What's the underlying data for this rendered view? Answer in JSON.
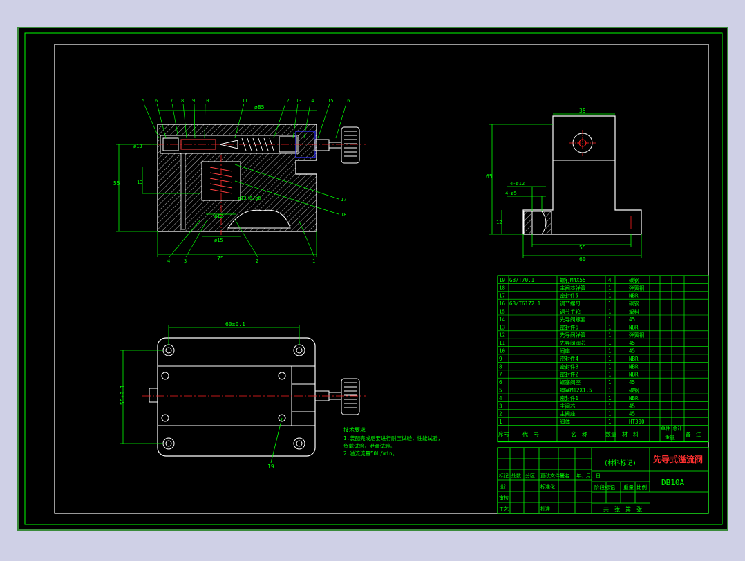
{
  "colors": {
    "background": "#cfd0e6",
    "paper": "#000000",
    "line": "#ffffff",
    "dimension": "#00ff00",
    "leader": "#00ff00",
    "center": "#ff2020",
    "hidden": "#3333ff",
    "hatch": "#ffffff"
  },
  "front_view": {
    "labels": {
      "top_width": "ø85",
      "bottom_width": "75",
      "left_height": "55",
      "small_h": "13",
      "dia_top": "ø13",
      "fit": "ø13H6/g5",
      "d12": "ø12",
      "d15": "ø15"
    },
    "part_numbers_top": [
      "5",
      "6",
      "7",
      "8",
      "9",
      "10",
      "11",
      "12",
      "13",
      "14",
      "15",
      "16"
    ],
    "part_numbers_right": [
      "17",
      "18"
    ],
    "part_numbers_bottom": [
      "4",
      "3",
      "2",
      "1"
    ]
  },
  "side_view": {
    "labels": {
      "top_width": "35",
      "height": "65",
      "holes_1": "4-ø12",
      "holes_2": "4-ø5",
      "base_h": "12",
      "inner_w": "55",
      "total_w": "60"
    }
  },
  "top_view": {
    "labels": {
      "top_dim": "60±0.1",
      "left_dim": "55±0.1",
      "part": "19"
    }
  },
  "tech_notes": [
    "技术要求",
    "1.装配完成后要进行耐压试验，性能试验，",
    "  负载试验，泄漏试验。",
    "2.溢流流量50L/min。"
  ],
  "bom": {
    "rows": [
      {
        "no": "19",
        "code": "GB/T70.1",
        "name": "螺钉M4X55",
        "qty": "4",
        "mat": "碳钢"
      },
      {
        "no": "18",
        "code": "",
        "name": "主阀芯弹簧",
        "qty": "1",
        "mat": "弹簧钢"
      },
      {
        "no": "17",
        "code": "",
        "name": "密封件5",
        "qty": "1",
        "mat": "NBR"
      },
      {
        "no": "16",
        "code": "GB/T6172.1",
        "name": "调节螺母",
        "qty": "1",
        "mat": "碳钢"
      },
      {
        "no": "15",
        "code": "",
        "name": "调节手轮",
        "qty": "1",
        "mat": "塑料"
      },
      {
        "no": "14",
        "code": "",
        "name": "先导阀螺套",
        "qty": "1",
        "mat": "45"
      },
      {
        "no": "13",
        "code": "",
        "name": "密封件6",
        "qty": "1",
        "mat": "NBR"
      },
      {
        "no": "12",
        "code": "",
        "name": "先导阀弹簧",
        "qty": "1",
        "mat": "弹簧钢"
      },
      {
        "no": "11",
        "code": "",
        "name": "先导阀阀芯",
        "qty": "1",
        "mat": "45"
      },
      {
        "no": "10",
        "code": "",
        "name": "阀座",
        "qty": "1",
        "mat": "45"
      },
      {
        "no": "9",
        "code": "",
        "name": "密封件4",
        "qty": "1",
        "mat": "NBR"
      },
      {
        "no": "8",
        "code": "",
        "name": "密封件3",
        "qty": "1",
        "mat": "NBR"
      },
      {
        "no": "7",
        "code": "",
        "name": "密封件2",
        "qty": "1",
        "mat": "NBR"
      },
      {
        "no": "6",
        "code": "",
        "name": "螺塞阀座",
        "qty": "1",
        "mat": "45"
      },
      {
        "no": "5",
        "code": "",
        "name": "螺塞M12X1.5",
        "qty": "1",
        "mat": "碳钢"
      },
      {
        "no": "4",
        "code": "",
        "name": "密封件1",
        "qty": "1",
        "mat": "NBR"
      },
      {
        "no": "3",
        "code": "",
        "name": "主阀芯",
        "qty": "1",
        "mat": "45"
      },
      {
        "no": "2",
        "code": "",
        "name": "主阀座",
        "qty": "1",
        "mat": "45"
      },
      {
        "no": "1",
        "code": "",
        "name": "阀体",
        "qty": "1",
        "mat": "HT300"
      }
    ],
    "header": {
      "no": "序号",
      "code": "代　号",
      "name": "名　称",
      "qty": "数量",
      "mat": "材　料",
      "unit_weight": "单件",
      "total_weight": "总计",
      "weight": "重量",
      "remark": "备　注"
    }
  },
  "title_block": {
    "material_mark": "(材料标记)",
    "title": "先导式溢流阀",
    "drawing_no": "DB10A",
    "r1": [
      "标记",
      "处数",
      "分区",
      "更改文件号",
      "签名",
      "年、月、日"
    ],
    "r2": [
      "设计",
      "",
      "",
      "标准化",
      "",
      ""
    ],
    "r3": [
      "审核",
      "",
      "",
      "",
      ""
    ],
    "r4": [
      "工艺",
      "",
      "",
      "批准"
    ],
    "stage": "阶段标记",
    "weight": "重量",
    "scale": "比例",
    "sheets": "共　张　第　张"
  }
}
